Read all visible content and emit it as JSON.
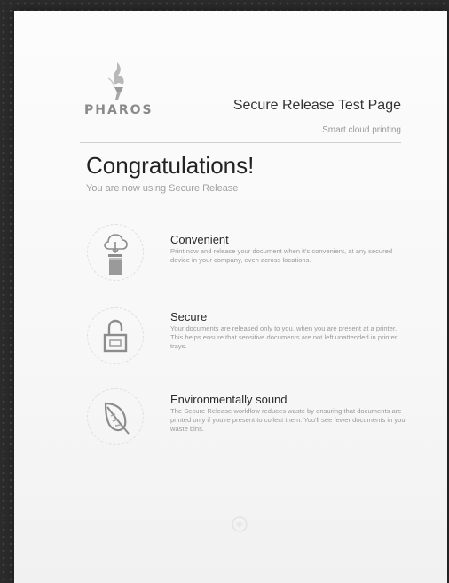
{
  "header": {
    "logo_text": "PHAROS",
    "title": "Secure Release Test Page",
    "subtitle": "Smart cloud printing"
  },
  "intro": {
    "headline": "Congratulations!",
    "subheadline": "You are now using Secure Release"
  },
  "features": [
    {
      "title": "Convenient",
      "description": "Print now and release your document when it's convenient, at any secured device in your company, even across locations.",
      "icon": "cloud-printer-icon"
    },
    {
      "title": "Secure",
      "description": "Your documents are released only to you, when you are present at a printer. This helps ensure that sensitive documents are not left unattended in printer trays.",
      "icon": "padlock-icon"
    },
    {
      "title": "Environmentally sound",
      "description": "The Secure Release workflow reduces waste by ensuring that documents are printed only if you're present to collect them. You'll see fewer documents in your waste bins.",
      "icon": "leaf-icon"
    }
  ],
  "colors": {
    "background": "#2b2b2b",
    "paper": "#f7f7f7",
    "headline": "#222222",
    "muted_text": "#9a9a9a",
    "icon_gray": "#8c8c8c"
  }
}
